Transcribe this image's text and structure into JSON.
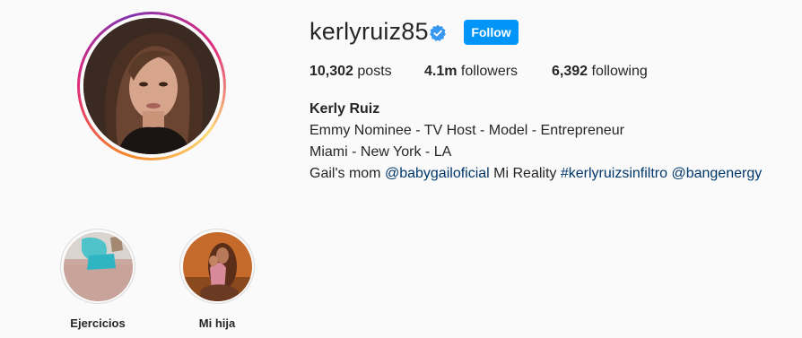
{
  "profile": {
    "username": "kerlyruiz85",
    "verified_icon": "verified-badge-icon",
    "follow_label": "Follow",
    "accent_color": "#0095f6",
    "link_color": "#00376b"
  },
  "stats": {
    "posts_count": "10,302",
    "posts_label": "posts",
    "followers_count": "4.1m",
    "followers_label": "followers",
    "following_count": "6,392",
    "following_label": "following"
  },
  "bio": {
    "name": "Kerly Ruiz",
    "line1": "Emmy Nominee - TV Host - Model - Entrepreneur",
    "line2": "Miami - New York - LA",
    "line3_prefix": "Gail's mom",
    "mention1": "@babygailoficial",
    "line3_middle": "Mi Reality",
    "hashtag": "#kerlyruizsinfiltro",
    "mention2": "@bangenergy"
  },
  "highlights": [
    {
      "label": "Ejercicios"
    },
    {
      "label": "Mi hija"
    }
  ]
}
